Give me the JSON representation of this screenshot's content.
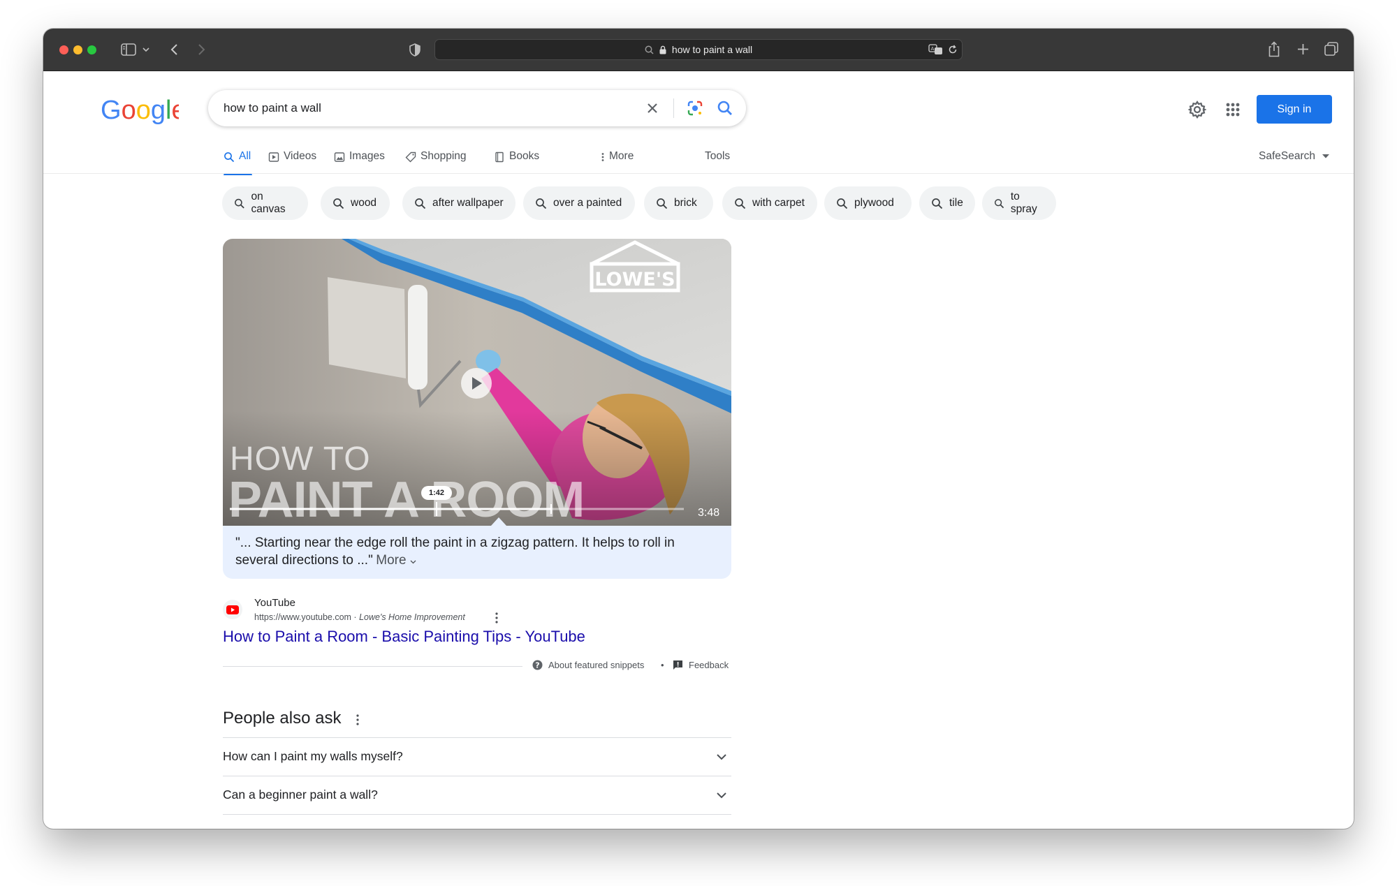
{
  "browser": {
    "url": "how to paint a wall"
  },
  "search": {
    "query": "how to paint a wall"
  },
  "header": {
    "sign_in": "Sign in"
  },
  "tabs": [
    {
      "label": "All",
      "icon": "search-icon",
      "active": true
    },
    {
      "label": "Videos",
      "icon": "video-icon"
    },
    {
      "label": "Images",
      "icon": "image-icon"
    },
    {
      "label": "Shopping",
      "icon": "tag-icon"
    },
    {
      "label": "Books",
      "icon": "book-icon"
    },
    {
      "label": "More",
      "icon": "more-vert-icon"
    }
  ],
  "tools_label": "Tools",
  "safesearch_label": "SafeSearch",
  "chips": [
    "on canvas",
    "wood",
    "after wallpaper",
    "over a painted",
    "brick",
    "with carpet",
    "plywood",
    "tile",
    "to spray"
  ],
  "video": {
    "brand": "LOWE'S",
    "overlay_line1": "HOW TO",
    "overlay_line2": "PAINT A ROOM",
    "current_time": "1:42",
    "duration": "3:48",
    "progress_fraction": 0.45
  },
  "snippet": {
    "text": "\"... Starting near the edge roll the paint in a zigzag pattern. It helps to roll in several directions to ...\"",
    "more": "More"
  },
  "source": {
    "name": "YouTube",
    "url": "https://www.youtube.com",
    "separator": " · ",
    "channel": "Lowe's Home Improvement"
  },
  "result": {
    "title": "How to Paint a Room - Basic Painting Tips - YouTube"
  },
  "snippet_footer": {
    "about": "About featured snippets",
    "dot": "•",
    "feedback": "Feedback"
  },
  "paa": {
    "title": "People also ask",
    "questions": [
      "How can I paint my walls myself?",
      "Can a beginner paint a wall?"
    ]
  },
  "colors": {
    "accent": "#1a73e8",
    "link": "#1a0dab",
    "snippet_bg": "#e8f0fe",
    "toolbar": "#383838"
  }
}
